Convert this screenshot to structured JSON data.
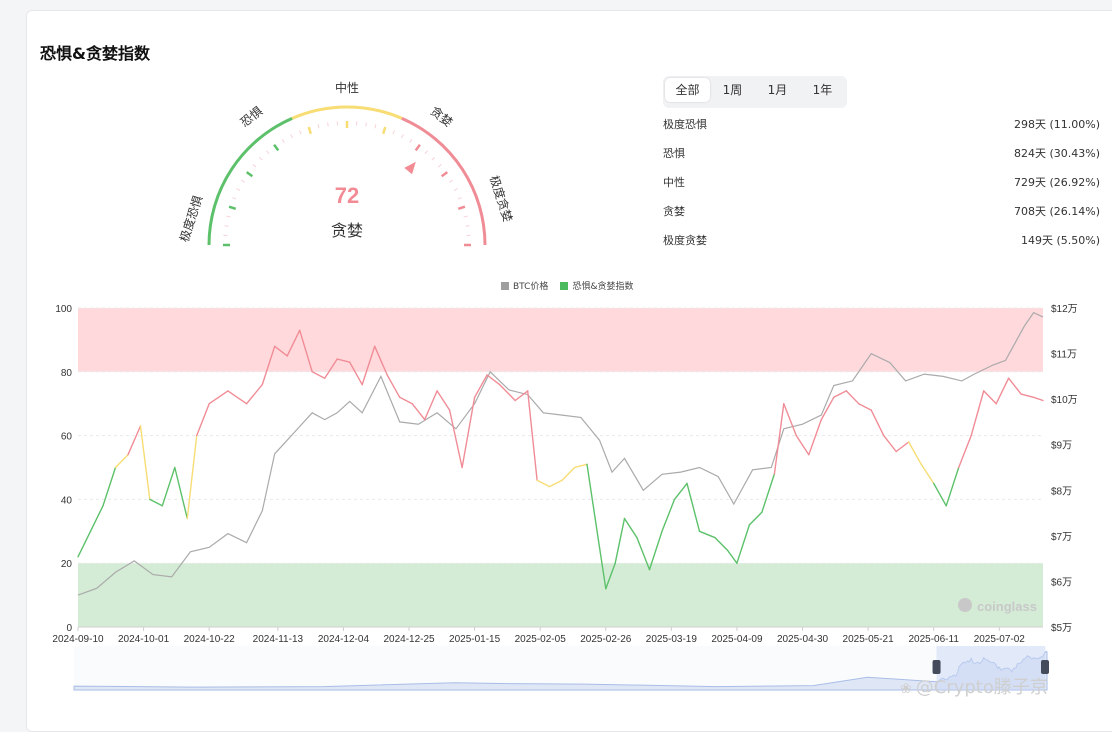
{
  "page": {
    "title": "恐惧&贪婪指数"
  },
  "gauge": {
    "value": 72,
    "label": "贪婪",
    "zones": [
      "极度恐惧",
      "恐惧",
      "中性",
      "贪婪",
      "极度贪婪"
    ],
    "colors": {
      "fear": "#5cc16a",
      "neutral": "#f7dd74",
      "greed": "#f08c96",
      "value": "#f28b94"
    }
  },
  "tabs": [
    {
      "label": "全部",
      "active": true
    },
    {
      "label": "1周",
      "active": false
    },
    {
      "label": "1月",
      "active": false
    },
    {
      "label": "1年",
      "active": false
    }
  ],
  "stats": [
    {
      "label": "极度恐惧",
      "value": "298天 (11.00%)"
    },
    {
      "label": "恐惧",
      "value": "824天 (30.43%)"
    },
    {
      "label": "中性",
      "value": "729天 (26.92%)"
    },
    {
      "label": "贪婪",
      "value": "708天 (26.14%)"
    },
    {
      "label": "极度贪婪",
      "value": "149天 (5.50%)"
    }
  ],
  "chart_data": {
    "type": "line",
    "legend": [
      {
        "name": "BTC价格",
        "color": "#9e9e9e"
      },
      {
        "name": "恐惧&贪婪指数",
        "color": "#4cbb5e"
      }
    ],
    "legend_position": "top-center",
    "x_ticks": [
      "2024-09-10",
      "2024-10-01",
      "2024-10-22",
      "2024-11-13",
      "2024-12-04",
      "2024-12-25",
      "2025-01-15",
      "2025-02-05",
      "2025-02-26",
      "2025-03-19",
      "2025-04-09",
      "2025-04-30",
      "2025-05-21",
      "2025-06-11",
      "2025-07-02"
    ],
    "y_left_ticks": [
      "0",
      "20",
      "40",
      "60",
      "80",
      "100"
    ],
    "y_left_range": [
      0,
      100
    ],
    "y_right_ticks": [
      "$5万",
      "$6万",
      "$7万",
      "$8万",
      "$9万",
      "$10万",
      "$11万",
      "$12万"
    ],
    "y_right_range": [
      50000,
      120000
    ],
    "bands": [
      {
        "from": 80,
        "to": 100,
        "color": "#ffd9dc"
      },
      {
        "from": 0,
        "to": 20,
        "color": "#d4ecd6"
      }
    ],
    "grid": true,
    "series": [
      {
        "name": "恐惧&贪婪指数",
        "axis": "left",
        "points": [
          [
            "2024-09-10",
            22
          ],
          [
            "2024-09-14",
            30
          ],
          [
            "2024-09-18",
            38
          ],
          [
            "2024-09-22",
            50
          ],
          [
            "2024-09-26",
            54
          ],
          [
            "2024-09-30",
            63
          ],
          [
            "2024-10-03",
            40
          ],
          [
            "2024-10-07",
            38
          ],
          [
            "2024-10-11",
            50
          ],
          [
            "2024-10-15",
            34
          ],
          [
            "2024-10-18",
            60
          ],
          [
            "2024-10-22",
            70
          ],
          [
            "2024-10-28",
            74
          ],
          [
            "2024-11-03",
            70
          ],
          [
            "2024-11-08",
            76
          ],
          [
            "2024-11-12",
            88
          ],
          [
            "2024-11-16",
            85
          ],
          [
            "2024-11-20",
            93
          ],
          [
            "2024-11-24",
            80
          ],
          [
            "2024-11-28",
            78
          ],
          [
            "2024-12-02",
            84
          ],
          [
            "2024-12-06",
            83
          ],
          [
            "2024-12-10",
            76
          ],
          [
            "2024-12-14",
            88
          ],
          [
            "2024-12-18",
            79
          ],
          [
            "2024-12-22",
            72
          ],
          [
            "2024-12-26",
            70
          ],
          [
            "2024-12-30",
            65
          ],
          [
            "2025-01-03",
            74
          ],
          [
            "2025-01-07",
            68
          ],
          [
            "2025-01-11",
            50
          ],
          [
            "2025-01-15",
            72
          ],
          [
            "2025-01-19",
            79
          ],
          [
            "2025-01-23",
            76
          ],
          [
            "2025-01-28",
            71
          ],
          [
            "2025-02-01",
            74
          ],
          [
            "2025-02-04",
            46
          ],
          [
            "2025-02-08",
            44
          ],
          [
            "2025-02-12",
            46
          ],
          [
            "2025-02-16",
            50
          ],
          [
            "2025-02-20",
            51
          ],
          [
            "2025-02-24",
            25
          ],
          [
            "2025-02-26",
            12
          ],
          [
            "2025-03-01",
            20
          ],
          [
            "2025-03-04",
            34
          ],
          [
            "2025-03-08",
            28
          ],
          [
            "2025-03-12",
            18
          ],
          [
            "2025-03-16",
            30
          ],
          [
            "2025-03-20",
            40
          ],
          [
            "2025-03-24",
            45
          ],
          [
            "2025-03-28",
            30
          ],
          [
            "2025-04-02",
            28
          ],
          [
            "2025-04-06",
            24
          ],
          [
            "2025-04-09",
            20
          ],
          [
            "2025-04-13",
            32
          ],
          [
            "2025-04-17",
            36
          ],
          [
            "2025-04-21",
            48
          ],
          [
            "2025-04-24",
            70
          ],
          [
            "2025-04-28",
            60
          ],
          [
            "2025-05-02",
            54
          ],
          [
            "2025-05-06",
            65
          ],
          [
            "2025-05-10",
            72
          ],
          [
            "2025-05-14",
            74
          ],
          [
            "2025-05-18",
            70
          ],
          [
            "2025-05-22",
            68
          ],
          [
            "2025-05-26",
            60
          ],
          [
            "2025-05-30",
            55
          ],
          [
            "2025-06-03",
            58
          ],
          [
            "2025-06-07",
            51
          ],
          [
            "2025-06-11",
            45
          ],
          [
            "2025-06-15",
            38
          ],
          [
            "2025-06-19",
            50
          ],
          [
            "2025-06-23",
            60
          ],
          [
            "2025-06-27",
            74
          ],
          [
            "2025-07-01",
            70
          ],
          [
            "2025-07-05",
            78
          ],
          [
            "2025-07-09",
            73
          ],
          [
            "2025-07-13",
            72
          ],
          [
            "2025-07-16",
            71
          ]
        ]
      },
      {
        "name": "BTC价格",
        "axis": "right",
        "points": [
          [
            "2024-09-10",
            57000
          ],
          [
            "2024-09-16",
            58500
          ],
          [
            "2024-09-22",
            62000
          ],
          [
            "2024-09-28",
            64500
          ],
          [
            "2024-10-04",
            61500
          ],
          [
            "2024-10-10",
            61000
          ],
          [
            "2024-10-16",
            66500
          ],
          [
            "2024-10-22",
            67500
          ],
          [
            "2024-10-28",
            70500
          ],
          [
            "2024-11-03",
            68500
          ],
          [
            "2024-11-08",
            75500
          ],
          [
            "2024-11-12",
            88000
          ],
          [
            "2024-11-16",
            91000
          ],
          [
            "2024-11-20",
            94000
          ],
          [
            "2024-11-24",
            97000
          ],
          [
            "2024-11-28",
            95500
          ],
          [
            "2024-12-02",
            97000
          ],
          [
            "2024-12-06",
            99500
          ],
          [
            "2024-12-10",
            97000
          ],
          [
            "2024-12-16",
            105000
          ],
          [
            "2024-12-22",
            95000
          ],
          [
            "2024-12-28",
            94500
          ],
          [
            "2025-01-03",
            97000
          ],
          [
            "2025-01-09",
            93500
          ],
          [
            "2025-01-15",
            99000
          ],
          [
            "2025-01-20",
            106000
          ],
          [
            "2025-01-26",
            102000
          ],
          [
            "2025-02-01",
            101000
          ],
          [
            "2025-02-06",
            97000
          ],
          [
            "2025-02-12",
            96500
          ],
          [
            "2025-02-18",
            96000
          ],
          [
            "2025-02-24",
            91000
          ],
          [
            "2025-02-28",
            84000
          ],
          [
            "2025-03-04",
            87000
          ],
          [
            "2025-03-10",
            80000
          ],
          [
            "2025-03-16",
            83500
          ],
          [
            "2025-03-22",
            84000
          ],
          [
            "2025-03-28",
            85000
          ],
          [
            "2025-04-03",
            83000
          ],
          [
            "2025-04-08",
            77000
          ],
          [
            "2025-04-14",
            84500
          ],
          [
            "2025-04-20",
            85000
          ],
          [
            "2025-04-24",
            93500
          ],
          [
            "2025-04-30",
            94500
          ],
          [
            "2025-05-06",
            96500
          ],
          [
            "2025-05-10",
            103000
          ],
          [
            "2025-05-16",
            104000
          ],
          [
            "2025-05-22",
            110000
          ],
          [
            "2025-05-28",
            108000
          ],
          [
            "2025-06-02",
            104000
          ],
          [
            "2025-06-08",
            105500
          ],
          [
            "2025-06-14",
            105000
          ],
          [
            "2025-06-20",
            104000
          ],
          [
            "2025-06-24",
            105500
          ],
          [
            "2025-06-30",
            107500
          ],
          [
            "2025-07-04",
            108500
          ],
          [
            "2025-07-10",
            116000
          ],
          [
            "2025-07-13",
            119000
          ],
          [
            "2025-07-16",
            118000
          ]
        ]
      }
    ],
    "colors": {
      "greed": "#f08c96",
      "neutral": "#f7dd74",
      "fear": "#5cc16a",
      "price": "#aaaaaa",
      "navigator": "#a9bde6"
    }
  },
  "chart_brand": "coinglass",
  "watermark": "@Crypto滕子京"
}
